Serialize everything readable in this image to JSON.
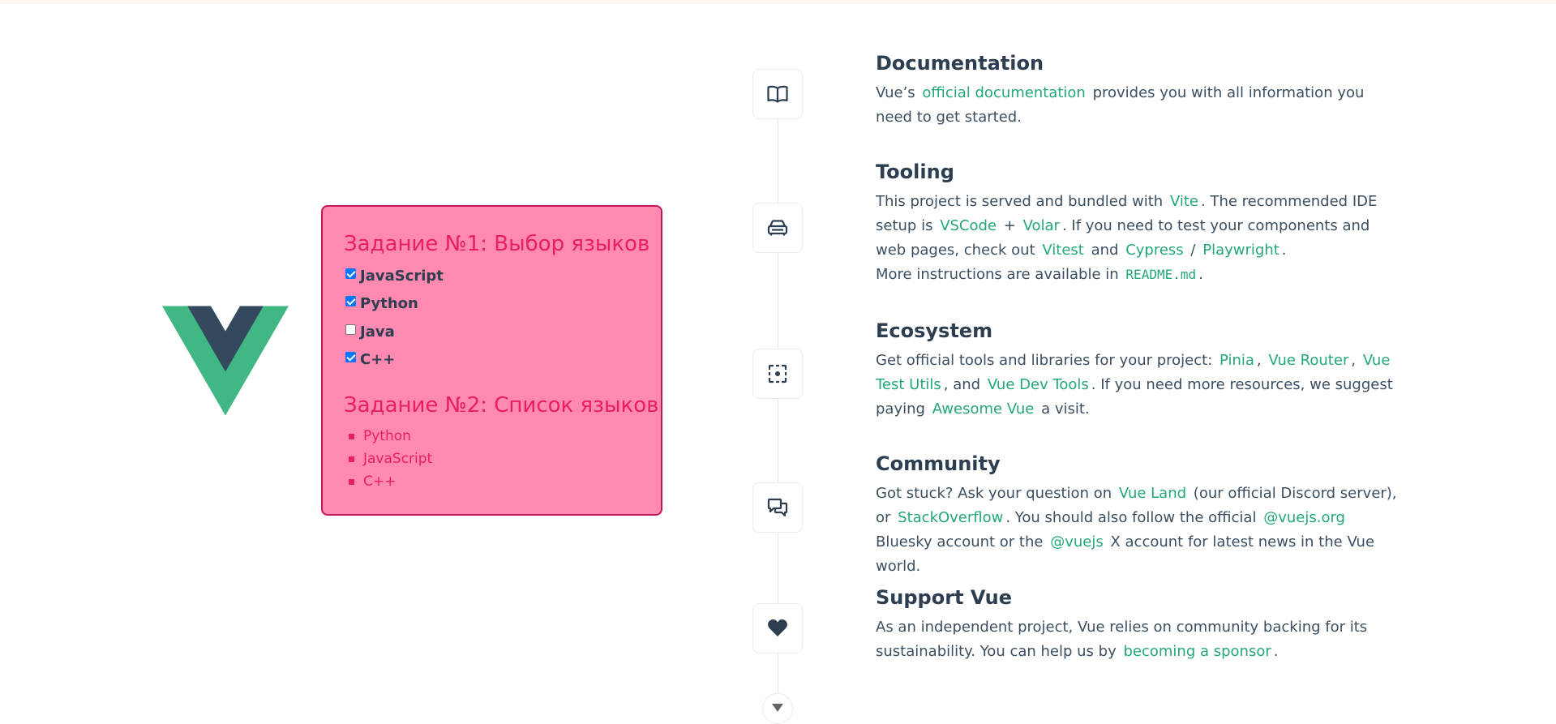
{
  "tasks": {
    "task1_title": "Задание №1: Выбор языков",
    "checkboxes": [
      {
        "label": "JavaScript",
        "checked": true
      },
      {
        "label": "Python",
        "checked": true
      },
      {
        "label": "Java",
        "checked": false
      },
      {
        "label": "C++",
        "checked": true
      }
    ],
    "task2_title": "Задание №2: Список языков",
    "list": [
      "Python",
      "JavaScript",
      "C++"
    ]
  },
  "sections": {
    "documentation": {
      "title": "Documentation",
      "t1": "Vue’s",
      "link1": "official documentation",
      "t2": "provides you with all information you need to get started."
    },
    "tooling": {
      "title": "Tooling",
      "t1": "This project is served and bundled with",
      "vite": "Vite",
      "t2": ". The recommended IDE setup is",
      "vscode": "VSCode",
      "plus": "+",
      "volar": "Volar",
      "t3": ". If you need to test your components and web pages, check out",
      "vitest": "Vitest",
      "and": "and",
      "cypress": "Cypress",
      "slash": "/",
      "playwright": "Playwright",
      "dot": ".",
      "t4": "More instructions are available in",
      "readme": "README.md",
      "dot2": "."
    },
    "ecosystem": {
      "title": "Ecosystem",
      "t1": "Get official tools and libraries for your project:",
      "pinia": "Pinia",
      "comma1": ",",
      "router": "Vue Router",
      "comma2": ",",
      "testutils": "Vue Test Utils",
      "t2": ", and",
      "devtools": "Vue Dev Tools",
      "t3": ". If you need more resources, we suggest paying",
      "awesome": "Awesome Vue",
      "t4": "a visit."
    },
    "community": {
      "title": "Community",
      "t1": "Got stuck? Ask your question on",
      "vueland": "Vue Land",
      "t2": "(our official Discord server), or",
      "stackoverflow": "StackOverflow",
      "t3": ". You should also follow the official",
      "bluesky": "@vuejs.org",
      "t4": "Bluesky account or the",
      "x": "@vuejs",
      "t5": "X account for latest news in the Vue world."
    },
    "support": {
      "title": "Support Vue",
      "t1": "As an independent project, Vue relies on community backing for its sustainability. You can help us by",
      "sponsor": "becoming a sponsor",
      "t2": "."
    }
  },
  "icons": [
    "book-icon",
    "tooling-icon",
    "ecosystem-icon",
    "community-icon",
    "heart-icon"
  ],
  "colors": {
    "accent": "#23a877",
    "task_box_bg": "#ff89b1",
    "task_box_border": "#c2185b",
    "task_title": "#e91e63",
    "heading": "#2c3e50"
  }
}
